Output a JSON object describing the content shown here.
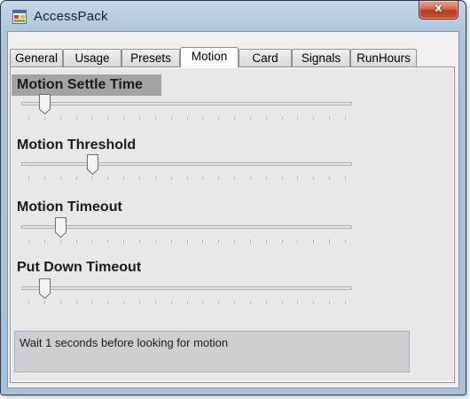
{
  "window": {
    "title": "AccessPack",
    "close_glyph": "x"
  },
  "tabs": [
    {
      "label": "General",
      "active": false
    },
    {
      "label": "Usage",
      "active": false
    },
    {
      "label": "Presets",
      "active": false
    },
    {
      "label": "Motion",
      "active": true
    },
    {
      "label": "Card",
      "active": false
    },
    {
      "label": "Signals",
      "active": false
    },
    {
      "label": "RunHours",
      "active": false
    }
  ],
  "settings": [
    {
      "label": "Motion Settle Time",
      "value": 1,
      "max": 20
    },
    {
      "label": "Motion Threshold",
      "value": 4,
      "max": 20
    },
    {
      "label": "Motion Timeout",
      "value": 2,
      "max": 20
    },
    {
      "label": "Put Down Timeout",
      "value": 1,
      "max": 20
    }
  ],
  "message": "Wait 1 seconds before looking for motion",
  "icons": {
    "app": "application-window-icon",
    "close": "close-icon"
  }
}
